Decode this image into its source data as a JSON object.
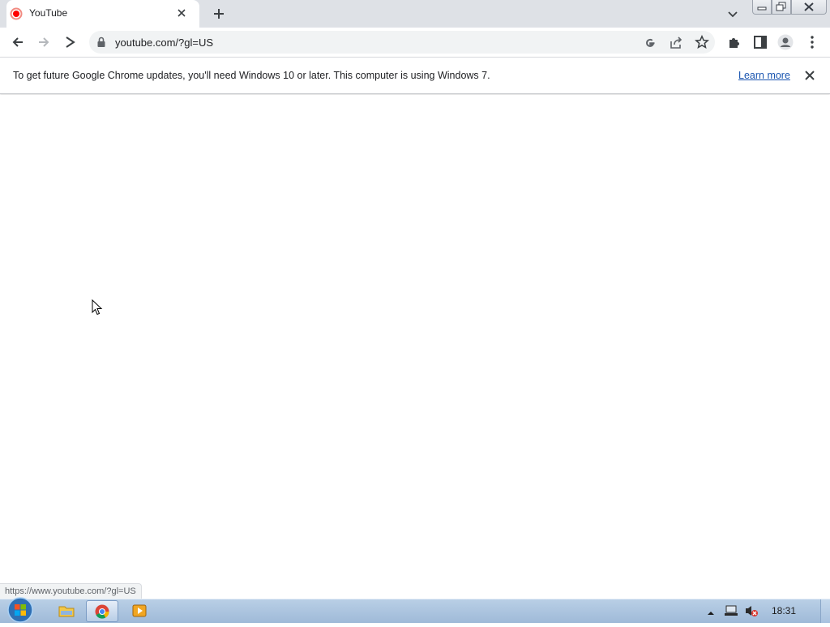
{
  "browser": {
    "tab": {
      "title": "YouTube",
      "favicon": "youtube-loading-icon"
    },
    "new_tab_icon": "plus-icon",
    "tab_search_icon": "chevron-down-icon"
  },
  "toolbar": {
    "back_icon": "arrow-left-icon",
    "forward_icon": "arrow-right-icon",
    "reload_icon": "loading-spinner-icon",
    "lock_icon": "lock-icon",
    "url": "youtube.com/?gl=US",
    "google_icon": "google-icon",
    "share_icon": "share-icon",
    "bookmark_icon": "star-icon",
    "extensions_icon": "puzzle-icon",
    "sidepanel_icon": "side-panel-icon",
    "profile_icon": "profile-icon",
    "menu_icon": "kebab-menu-icon"
  },
  "infobar": {
    "message": "To get future Google Chrome updates, you'll need Windows 10 or later. This computer is using Windows 7.",
    "learn_more": "Learn more",
    "close_icon": "close-icon"
  },
  "status_bar": {
    "url": "https://www.youtube.com/?gl=US"
  },
  "taskbar": {
    "start_icon": "windows-start-icon",
    "pinned": [
      "file-explorer-icon",
      "chrome-icon",
      "media-player-icon"
    ],
    "active": "chrome-icon",
    "tray_icons": [
      "show-hidden-icons-icon",
      "network-icon",
      "volume-muted-icon"
    ],
    "clock": "18:31"
  },
  "colors": {
    "tabstrip": "#dee1e6",
    "omnibox": "#f1f3f4",
    "link": "#1a55b0",
    "taskbar": "#a9c2df",
    "youtube_red": "#ff0000"
  }
}
